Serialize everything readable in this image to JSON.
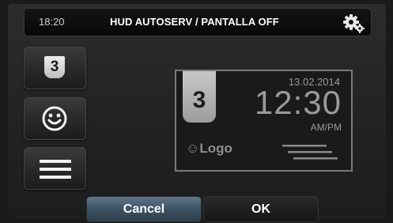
{
  "header": {
    "time": "18:20",
    "title": "HUD AUTOSERV / PANTALLA OFF",
    "settings_icon": "gear-icon"
  },
  "side_buttons": {
    "number_label": "3",
    "logo_icon": "smiley-icon",
    "menu_icon": "lines-icon"
  },
  "preview": {
    "number": "3",
    "date": "13.02.2014",
    "time": "12:30",
    "ampm": "AM/PM",
    "logo": "☺Logo"
  },
  "footer": {
    "cancel_label": "Cancel",
    "ok_label": "OK"
  },
  "colors": {
    "cancel_accent": "#4b6475",
    "background": "#222222"
  }
}
